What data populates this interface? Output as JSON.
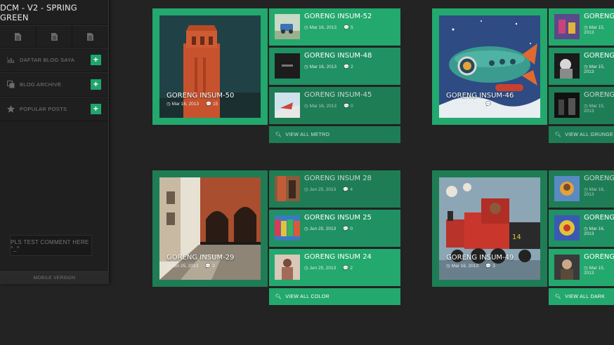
{
  "sidebar": {
    "title": "DCM - V2 - SPRING GREEN",
    "menu": [
      {
        "label": "DAFTAR BLOG SAYA",
        "icon": "chart-icon"
      },
      {
        "label": "BLOG ARCHIVE",
        "icon": "copy-icon"
      },
      {
        "label": "POPULAR POSTS",
        "icon": "star-icon"
      }
    ],
    "plus": "+",
    "comment_button": "PLS TEST COMMENT HERE ^_^",
    "mobile": "MOBILE VERSION"
  },
  "colors": {
    "green": "#23a86e",
    "green_dark": "#1e7d55",
    "green_mid": "#1f9163"
  },
  "sections": [
    {
      "featured": {
        "title": "GORENG INSUM-50",
        "date": "Mar 16, 2013",
        "comments": "15"
      },
      "items": [
        {
          "title": "GORENG INSUM-52",
          "date": "Mar 16, 2013",
          "comments": "5"
        },
        {
          "title": "GORENG INSUM-48",
          "date": "Mar 16, 2013",
          "comments": "2"
        },
        {
          "title": "GORENG INSUM-45",
          "date": "Mar 16, 2013",
          "comments": "0"
        }
      ],
      "view_all": "VIEW ALL METRO"
    },
    {
      "featured": {
        "title": "GORENG INSUM-46",
        "date": "Mar 16, 2013",
        "comments": "3"
      },
      "items": [
        {
          "title": "GORENG INS",
          "date": "Mar 15, 2013"
        },
        {
          "title": "GORENG INS",
          "date": "Mar 15, 2013"
        },
        {
          "title": "GORENG INS",
          "date": "Mar 15, 2013"
        }
      ],
      "view_all": "VIEW ALL GRUNGE"
    },
    {
      "featured": {
        "title": "GORENG INSUM-29",
        "date": "Jun 25, 2013",
        "comments": "2"
      },
      "items": [
        {
          "title": "GORENG INSUM 28",
          "date": "Jun 25, 2013",
          "comments": "4"
        },
        {
          "title": "GORENG INSUM 25",
          "date": "Jun 25, 2013",
          "comments": "0"
        },
        {
          "title": "GORENG INSUM 24",
          "date": "Jun 25, 2013",
          "comments": "2"
        }
      ],
      "view_all": "VIEW ALL COLOR"
    },
    {
      "featured": {
        "title": "GORENG INSUM-49",
        "date": "Mar 16, 2013",
        "comments": "3"
      },
      "items": [
        {
          "title": "GORENG INS",
          "date": "Mar 16, 2013"
        },
        {
          "title": "GORENG INS",
          "date": "Mar 16, 2013"
        },
        {
          "title": "GORENG INS",
          "date": "Mar 15, 2013"
        }
      ],
      "view_all": "VIEW ALL DARK"
    }
  ]
}
